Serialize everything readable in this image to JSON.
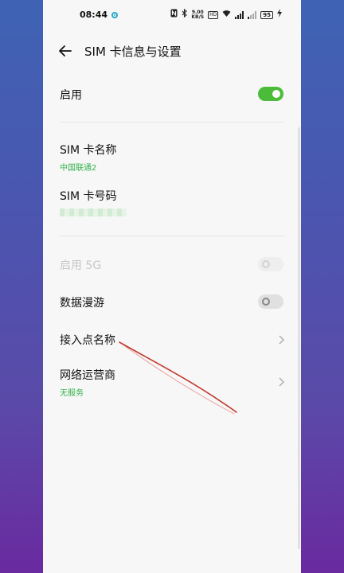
{
  "status_bar": {
    "time": "08:44",
    "net_speed_value": "9.00",
    "net_speed_unit": "KB/S",
    "hd": "HD",
    "battery": "95"
  },
  "header": {
    "title": "SIM 卡信息与设置"
  },
  "settings": {
    "enable": {
      "label": "启用",
      "state": "on"
    },
    "sim_name": {
      "label": "SIM 卡名称",
      "value": "中国联通2"
    },
    "sim_number": {
      "label": "SIM 卡号码"
    },
    "enable_5g": {
      "label": "启用 5G",
      "state": "disabled"
    },
    "data_roaming": {
      "label": "数据漫游",
      "state": "off"
    },
    "apn": {
      "label": "接入点名称"
    },
    "network_operator": {
      "label": "网络运营商",
      "value": "无服务"
    }
  },
  "colors": {
    "accent": "#4cbb3a",
    "subtext": "#35b24a",
    "annotation": "#c0392b"
  }
}
